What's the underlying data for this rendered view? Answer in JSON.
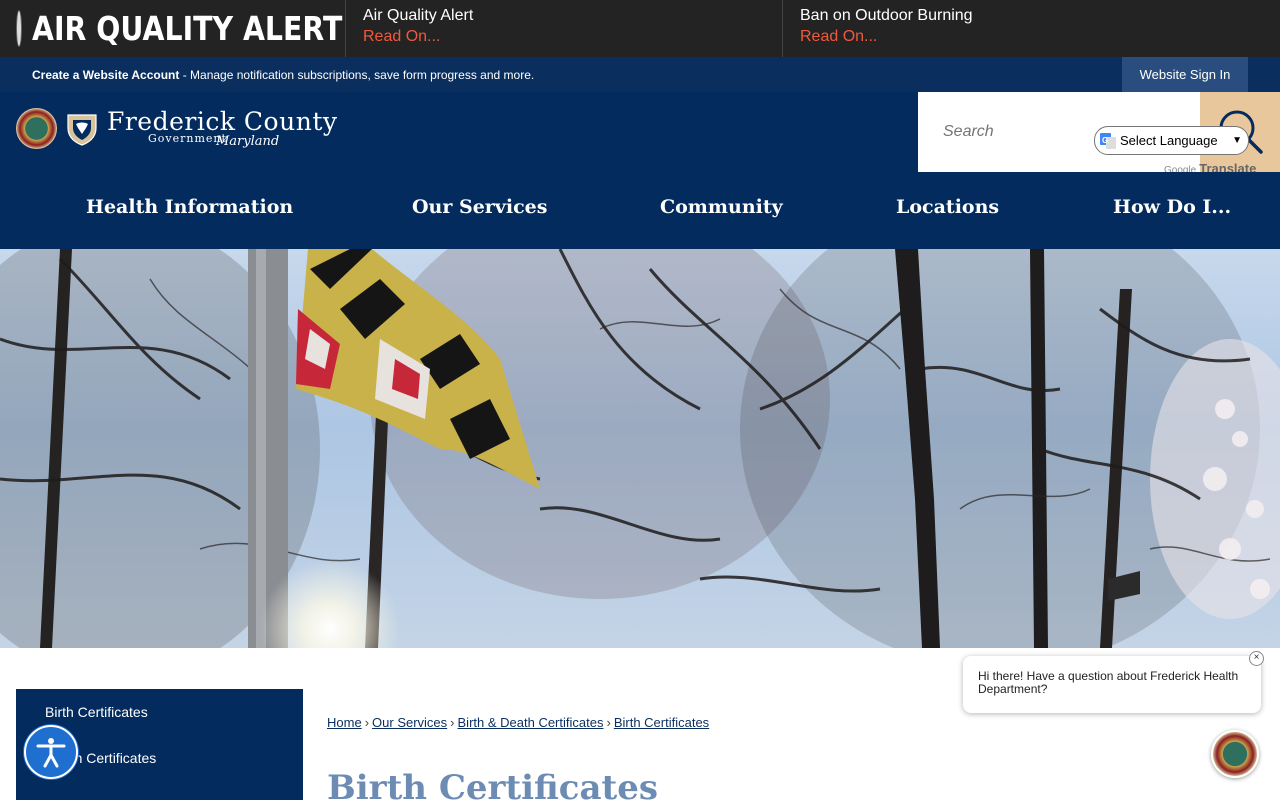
{
  "alert": {
    "title": "AIR QUALITY ALERT",
    "items": [
      {
        "title": "Air Quality Alert",
        "link": "Read On..."
      },
      {
        "title": "Ban on Outdoor Burning",
        "link": "Read On..."
      }
    ]
  },
  "account": {
    "create_label": "Create a Website Account",
    "description": " - Manage notification subscriptions, save form progress and more.",
    "signin_label": "Website Sign In"
  },
  "header": {
    "logo_name": "Frederick County",
    "logo_sub": "Government",
    "logo_script": "Maryland",
    "search_placeholder": "Search",
    "translate_label": "Select Language",
    "powered_by": "Google",
    "translate_word": "Translate"
  },
  "nav": {
    "items": [
      "Health Information",
      "Our Services",
      "Community",
      "Locations",
      "How Do I..."
    ]
  },
  "sidebar": {
    "items": [
      "Birth Certificates",
      "Death Certificates"
    ]
  },
  "breadcrumb": [
    "Home",
    "Our Services",
    "Birth & Death Certificates",
    "Birth Certificates"
  ],
  "page": {
    "title": "Birth Certificates"
  },
  "chat": {
    "message": "Hi there! Have a question about Frederick Health Department?",
    "close": "×"
  },
  "colors": {
    "navy": "#032b5d",
    "alert_link": "#f05a3c",
    "search_button": "#e8c79c",
    "accessibility": "#1f6fd1"
  }
}
